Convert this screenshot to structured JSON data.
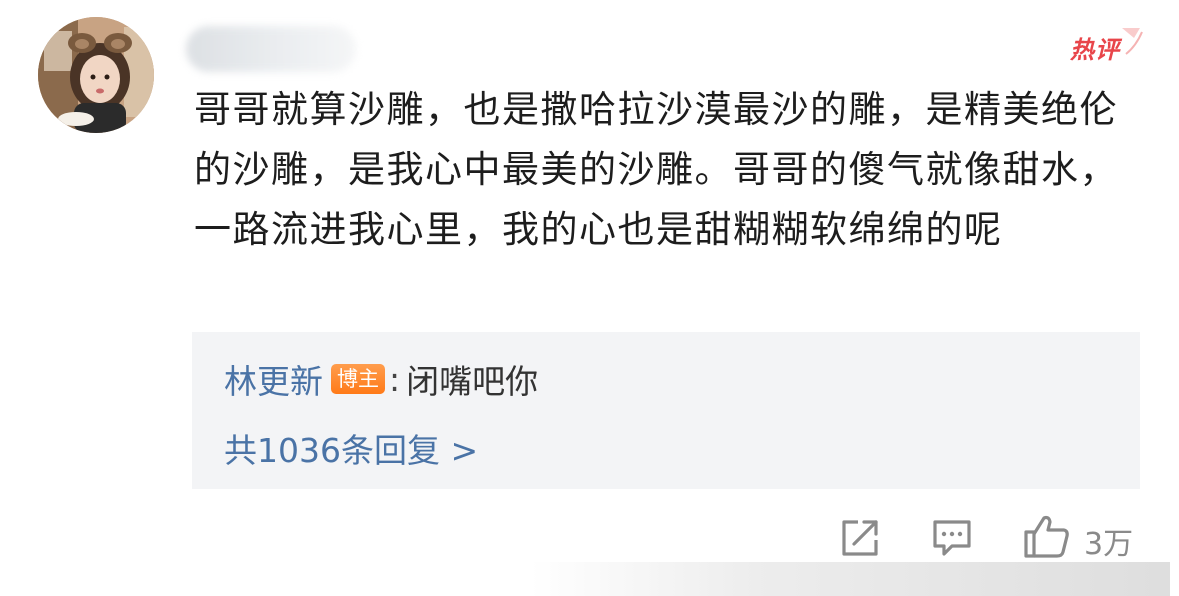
{
  "comment": {
    "hot_label": "热评",
    "text": "哥哥就算沙雕，也是撒哈拉沙漠最沙的雕，是精美绝伦的沙雕，是我心中最美的沙雕。哥哥的傻气就像甜水，一路流进我心里，我的心也是甜糊糊软绵绵的呢"
  },
  "reply": {
    "author": "林更新",
    "badge": "博主",
    "separator": ":",
    "content": "闭嘴吧你",
    "count_text": "共1036条回复 >"
  },
  "actions": {
    "like_count": "3万"
  },
  "icons": {
    "repost": "repost-icon",
    "comment": "comment-icon",
    "like": "thumbs-up-icon"
  },
  "colors": {
    "link_blue": "#4a73a6",
    "hot_red": "#e8454a",
    "badge_orange": "#ff7a18",
    "reply_bg": "#f3f4f6",
    "icon_gray": "#8a8a8a"
  }
}
